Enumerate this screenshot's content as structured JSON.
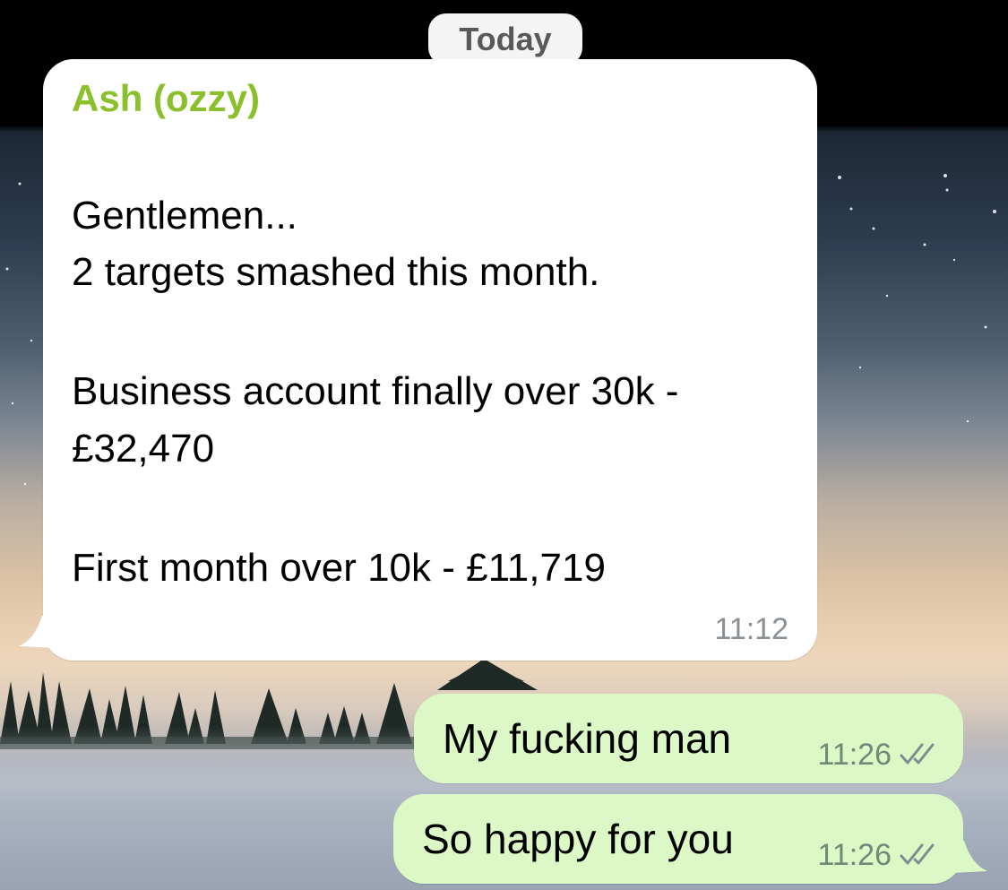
{
  "date_chip": "Today",
  "incoming": {
    "sender": "Ash (ozzy)",
    "lines": [
      "Gentlemen...",
      "2 targets smashed this month.",
      "Business account finally over 30k -",
      "£32,470",
      "First month over 10k - £11,719"
    ],
    "time": "11:12"
  },
  "outgoing": [
    {
      "text": "My fucking man",
      "time": "11:26",
      "status_icon": "double-check-icon"
    },
    {
      "text": "So happy for you",
      "time": "11:26",
      "status_icon": "double-check-icon"
    }
  ],
  "colors": {
    "sender_name": "#8bbf2c",
    "outgoing_bubble": "#dcf8c6",
    "incoming_bubble": "#ffffff"
  }
}
